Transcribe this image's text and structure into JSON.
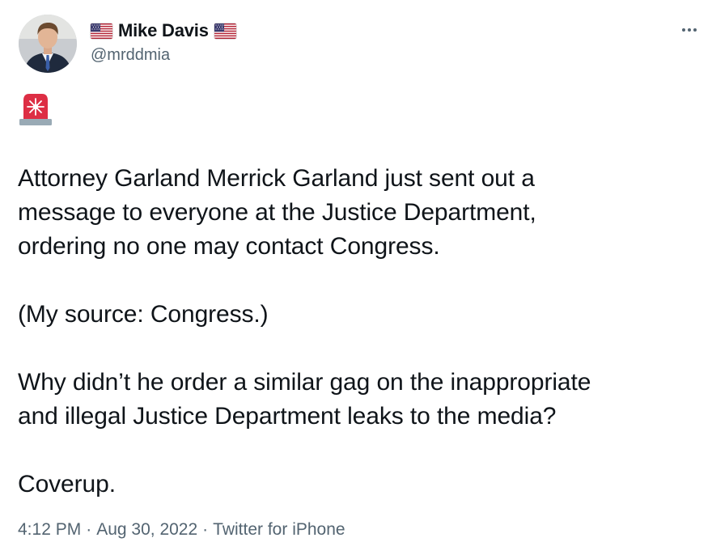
{
  "user": {
    "display_name": "Mike Davis",
    "handle": "@mrddmia",
    "name_prefix_icon": "us-flag-icon",
    "name_suffix_icon": "us-flag-icon",
    "avatar_icon": "profile-photo"
  },
  "menu": {
    "icon": "more-options-icon"
  },
  "tweet": {
    "lead_emoji_icon": "police-light-siren-icon",
    "paragraphs": [
      "Attorney Garland Merrick Garland just sent out a",
      "message to everyone at the Justice Department,",
      "ordering no one may contact Congress.",
      "(My source: Congress.)",
      "Why didn’t he order a similar gag on the inappropriate",
      "and illegal Justice Department leaks to the media?",
      "Coverup."
    ]
  },
  "meta": {
    "time": "4:12 PM",
    "separator": "·",
    "date": "Aug 30, 2022",
    "source": "Twitter for iPhone"
  },
  "colors": {
    "text": "#0f1419",
    "secondary": "#536471",
    "siren_red": "#d93a4a",
    "flag_red": "#b22234",
    "flag_blue": "#3c3b6e"
  }
}
